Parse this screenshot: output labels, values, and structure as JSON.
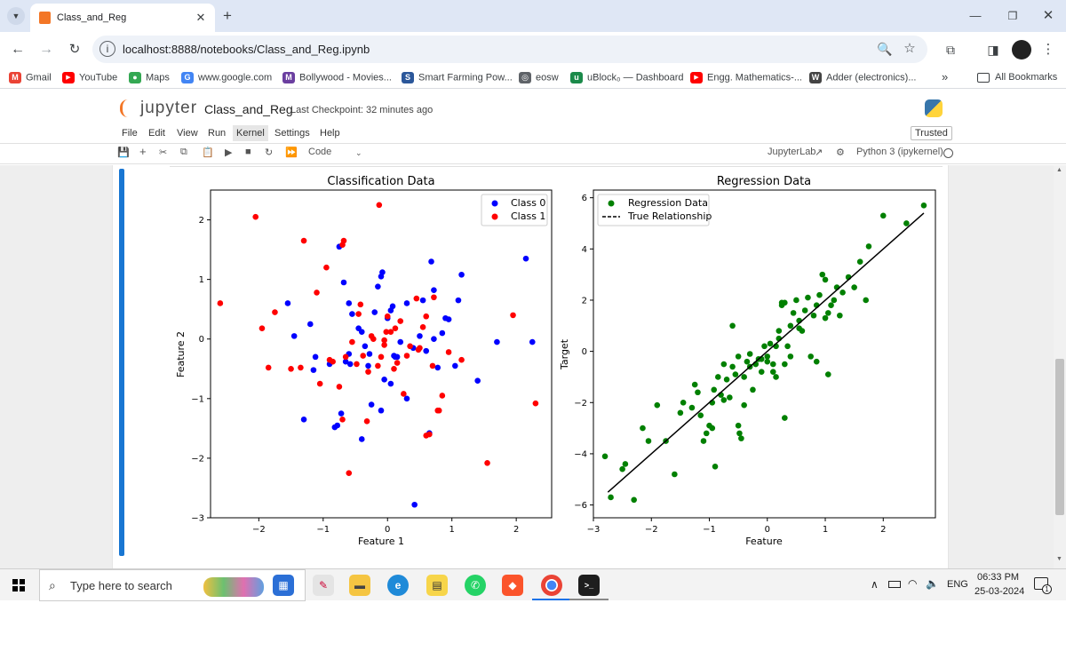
{
  "browser": {
    "tab_title": "Class_and_Reg",
    "url": "localhost:8888/notebooks/Class_and_Reg.ipynb",
    "bookmarks": [
      {
        "label": "Gmail",
        "icon": "gmail-icon",
        "color": "#ea4335",
        "glyph": "M"
      },
      {
        "label": "YouTube",
        "icon": "youtube-icon",
        "color": "#ff0000",
        "glyph": "▶"
      },
      {
        "label": "Maps",
        "icon": "maps-icon",
        "color": "#34a853",
        "glyph": "●"
      },
      {
        "label": "www.google.com",
        "icon": "google-icon",
        "color": "#4285f4",
        "glyph": "G"
      },
      {
        "label": "Bollywood - Movies...",
        "icon": "bollywood-icon",
        "color": "#6b3fa0",
        "glyph": "M"
      },
      {
        "label": "Smart Farming Pow...",
        "icon": "smart-farming-icon",
        "color": "#2b579a",
        "glyph": "S"
      },
      {
        "label": "eosw",
        "icon": "globe-icon",
        "color": "#5f6368",
        "glyph": "◎"
      },
      {
        "label": "uBlock₀ — Dashboard",
        "icon": "ublock-icon",
        "color": "#1b8a4a",
        "glyph": "u"
      },
      {
        "label": "Engg. Mathematics-...",
        "icon": "youtube-icon",
        "color": "#ff0000",
        "glyph": "▶"
      },
      {
        "label": "Adder (electronics)...",
        "icon": "wikipedia-icon",
        "color": "#444444",
        "glyph": "W"
      }
    ],
    "more_bookmarks": "»",
    "all_bookmarks": "All Bookmarks"
  },
  "jupyter": {
    "logo_text": "jupyter",
    "notebook_name": "Class_and_Reg",
    "checkpoint": "Last Checkpoint: 32 minutes ago",
    "trusted": "Trusted",
    "menu": [
      "File",
      "Edit",
      "View",
      "Run",
      "Kernel",
      "Settings",
      "Help"
    ],
    "cell_type": "Code",
    "jupyterlab_link": "JupyterLab",
    "kernel_name": "Python 3 (ipykernel)"
  },
  "taskbar": {
    "search_placeholder": "Type here to search",
    "language": "ENG",
    "time": "06:33 PM",
    "date": "25-03-2024",
    "notification_count": "1"
  },
  "chart_data": [
    {
      "type": "scatter",
      "title": "Classification Data",
      "xlabel": "Feature 1",
      "ylabel": "Feature 2",
      "xlim": [
        -2.75,
        2.55
      ],
      "ylim": [
        -3.0,
        2.5
      ],
      "xticks": [
        -2,
        -1,
        0,
        1,
        2
      ],
      "yticks": [
        -3,
        -2,
        -1,
        0,
        1,
        2
      ],
      "legend_position": "upper-right",
      "series": [
        {
          "name": "Class 0",
          "color": "#0000ff",
          "points": [
            [
              -1.3,
              -1.35
            ],
            [
              -1.15,
              -0.52
            ],
            [
              -1.12,
              -0.3
            ],
            [
              -0.9,
              -0.42
            ],
            [
              -0.65,
              -0.38
            ],
            [
              -0.6,
              -0.25
            ],
            [
              -0.55,
              0.42
            ],
            [
              -0.45,
              0.18
            ],
            [
              -0.4,
              0.12
            ],
            [
              -0.35,
              -0.12
            ],
            [
              -0.3,
              -0.45
            ],
            [
              -0.25,
              -1.1
            ],
            [
              -0.2,
              0.45
            ],
            [
              -0.15,
              0.88
            ],
            [
              -0.1,
              1.05
            ],
            [
              -0.08,
              1.12
            ],
            [
              0.0,
              0.35
            ],
            [
              0.05,
              0.48
            ],
            [
              0.08,
              0.55
            ],
            [
              0.12,
              -0.3
            ],
            [
              0.15,
              -0.3
            ],
            [
              0.2,
              -0.05
            ],
            [
              0.3,
              -1.0
            ],
            [
              0.4,
              -0.15
            ],
            [
              0.5,
              0.05
            ],
            [
              0.55,
              0.65
            ],
            [
              0.6,
              -0.2
            ],
            [
              0.65,
              -1.58
            ],
            [
              0.68,
              1.3
            ],
            [
              0.72,
              0.0
            ],
            [
              0.78,
              -0.48
            ],
            [
              0.85,
              0.1
            ],
            [
              0.9,
              0.35
            ],
            [
              0.95,
              0.33
            ],
            [
              1.05,
              -0.45
            ],
            [
              1.1,
              0.65
            ],
            [
              1.15,
              1.08
            ],
            [
              1.4,
              -0.7
            ],
            [
              1.7,
              -0.05
            ],
            [
              2.15,
              1.35
            ],
            [
              2.25,
              -0.05
            ],
            [
              -0.72,
              -1.25
            ],
            [
              -0.78,
              -1.45
            ],
            [
              -0.82,
              -1.48
            ],
            [
              -0.75,
              1.55
            ],
            [
              -0.68,
              0.95
            ],
            [
              -0.6,
              0.6
            ],
            [
              -1.2,
              0.25
            ],
            [
              -1.55,
              0.6
            ],
            [
              -1.45,
              0.05
            ],
            [
              -0.58,
              -0.42
            ],
            [
              -0.4,
              -1.68
            ],
            [
              -0.05,
              -0.68
            ],
            [
              0.05,
              -0.75
            ],
            [
              -0.1,
              -1.2
            ],
            [
              0.42,
              -2.78
            ],
            [
              0.72,
              0.82
            ],
            [
              0.3,
              0.6
            ],
            [
              0.1,
              -0.28
            ],
            [
              -0.28,
              -0.25
            ]
          ]
        },
        {
          "name": "Class 1",
          "color": "#ff0000",
          "points": [
            [
              -2.6,
              0.6
            ],
            [
              -2.05,
              2.05
            ],
            [
              -1.95,
              0.18
            ],
            [
              -1.85,
              -0.48
            ],
            [
              -1.75,
              0.45
            ],
            [
              -1.5,
              -0.5
            ],
            [
              -1.35,
              -0.48
            ],
            [
              -1.3,
              1.65
            ],
            [
              -1.1,
              0.78
            ],
            [
              -1.05,
              -0.75
            ],
            [
              -0.95,
              1.2
            ],
            [
              -0.85,
              -0.38
            ],
            [
              -0.75,
              -0.8
            ],
            [
              -0.7,
              1.58
            ],
            [
              -0.68,
              1.65
            ],
            [
              -0.65,
              -0.3
            ],
            [
              -0.6,
              -2.25
            ],
            [
              -0.55,
              -0.05
            ],
            [
              -0.48,
              -0.42
            ],
            [
              -0.42,
              0.58
            ],
            [
              -0.38,
              -0.28
            ],
            [
              -0.3,
              -0.55
            ],
            [
              -0.25,
              0.05
            ],
            [
              -0.15,
              -0.45
            ],
            [
              -0.1,
              -0.3
            ],
            [
              -0.05,
              -0.1
            ],
            [
              0.0,
              0.38
            ],
            [
              0.05,
              0.12
            ],
            [
              0.12,
              0.18
            ],
            [
              0.15,
              -0.4
            ],
            [
              0.25,
              -0.92
            ],
            [
              0.35,
              -0.12
            ],
            [
              0.45,
              0.68
            ],
            [
              0.5,
              -0.15
            ],
            [
              0.6,
              0.38
            ],
            [
              0.65,
              -1.6
            ],
            [
              0.7,
              -0.45
            ],
            [
              0.72,
              0.7
            ],
            [
              0.8,
              -1.2
            ],
            [
              0.85,
              -0.95
            ],
            [
              1.55,
              -2.08
            ],
            [
              1.95,
              0.4
            ],
            [
              2.3,
              -1.08
            ],
            [
              -0.13,
              2.25
            ],
            [
              0.3,
              -0.28
            ],
            [
              -0.32,
              -1.38
            ],
            [
              0.6,
              -1.62
            ],
            [
              0.78,
              -1.2
            ],
            [
              -0.02,
              0.12
            ],
            [
              -0.9,
              -0.35
            ],
            [
              0.2,
              0.3
            ],
            [
              -0.45,
              0.42
            ],
            [
              -0.22,
              0.0
            ],
            [
              0.48,
              -0.18
            ],
            [
              0.95,
              -0.22
            ],
            [
              -0.7,
              -1.35
            ],
            [
              0.1,
              -0.5
            ],
            [
              -0.05,
              -0.02
            ],
            [
              0.55,
              0.2
            ],
            [
              1.15,
              -0.35
            ]
          ]
        }
      ]
    },
    {
      "type": "scatter",
      "title": "Regression Data",
      "xlabel": "Feature",
      "ylabel": "Target",
      "xlim": [
        -3.0,
        2.9
      ],
      "ylim": [
        -6.5,
        6.3
      ],
      "xticks": [
        -3,
        -2,
        -1,
        0,
        1,
        2
      ],
      "yticks": [
        -6,
        -4,
        -2,
        0,
        2,
        4,
        6
      ],
      "legend_position": "upper-left",
      "series": [
        {
          "name": "Regression Data",
          "color": "#008000",
          "points": [
            [
              -2.7,
              -5.7
            ],
            [
              -2.8,
              -4.1
            ],
            [
              -2.5,
              -4.6
            ],
            [
              -2.45,
              -4.4
            ],
            [
              -2.3,
              -5.8
            ],
            [
              -2.15,
              -3.0
            ],
            [
              -2.05,
              -3.5
            ],
            [
              -1.9,
              -2.1
            ],
            [
              -1.75,
              -3.5
            ],
            [
              -1.6,
              -4.8
            ],
            [
              -1.5,
              -2.4
            ],
            [
              -1.45,
              -2.0
            ],
            [
              -1.3,
              -2.2
            ],
            [
              -1.25,
              -1.3
            ],
            [
              -1.1,
              -3.5
            ],
            [
              -1.05,
              -3.2
            ],
            [
              -1.0,
              -2.9
            ],
            [
              -0.95,
              -2.0
            ],
            [
              -0.92,
              -1.5
            ],
            [
              -0.9,
              -4.5
            ],
            [
              -0.85,
              -1.0
            ],
            [
              -0.8,
              -1.7
            ],
            [
              -0.75,
              -0.5
            ],
            [
              -0.7,
              -1.1
            ],
            [
              -0.65,
              -1.8
            ],
            [
              -0.6,
              -0.6
            ],
            [
              -0.55,
              -0.9
            ],
            [
              -0.5,
              -2.9
            ],
            [
              -0.48,
              -3.2
            ],
            [
              -0.45,
              -3.4
            ],
            [
              -0.4,
              -1.0
            ],
            [
              -0.35,
              -0.4
            ],
            [
              -0.3,
              -0.1
            ],
            [
              -0.25,
              -1.5
            ],
            [
              -0.2,
              -0.5
            ],
            [
              -0.15,
              -0.3
            ],
            [
              -0.1,
              -0.8
            ],
            [
              -0.05,
              0.2
            ],
            [
              0.0,
              -0.2
            ],
            [
              0.05,
              0.3
            ],
            [
              0.1,
              -0.5
            ],
            [
              0.15,
              -1.0
            ],
            [
              0.2,
              0.5
            ],
            [
              0.25,
              1.8
            ],
            [
              0.3,
              -0.5
            ],
            [
              0.3,
              -2.6
            ],
            [
              0.35,
              0.2
            ],
            [
              0.4,
              1.0
            ],
            [
              0.45,
              1.5
            ],
            [
              0.5,
              2.0
            ],
            [
              0.55,
              1.2
            ],
            [
              0.6,
              0.8
            ],
            [
              0.65,
              1.6
            ],
            [
              0.7,
              2.1
            ],
            [
              0.75,
              -0.2
            ],
            [
              0.8,
              1.4
            ],
            [
              0.85,
              1.8
            ],
            [
              0.9,
              2.2
            ],
            [
              0.95,
              3.0
            ],
            [
              1.0,
              2.8
            ],
            [
              1.05,
              1.5
            ],
            [
              1.1,
              1.8
            ],
            [
              1.15,
              2.0
            ],
            [
              1.2,
              2.5
            ],
            [
              1.25,
              1.4
            ],
            [
              1.3,
              2.3
            ],
            [
              1.4,
              2.9
            ],
            [
              1.5,
              2.5
            ],
            [
              1.6,
              3.5
            ],
            [
              1.7,
              2.0
            ],
            [
              1.75,
              4.1
            ],
            [
              2.0,
              5.3
            ],
            [
              2.4,
              5.0
            ],
            [
              2.7,
              5.7
            ],
            [
              -0.4,
              -2.1
            ],
            [
              -0.6,
              1.0
            ],
            [
              0.0,
              -0.4
            ],
            [
              0.15,
              0.2
            ],
            [
              0.25,
              1.9
            ],
            [
              0.3,
              1.9
            ],
            [
              0.55,
              0.9
            ],
            [
              0.85,
              -0.4
            ],
            [
              1.0,
              1.3
            ],
            [
              1.05,
              -0.9
            ],
            [
              -1.2,
              -1.6
            ],
            [
              -1.15,
              -2.5
            ],
            [
              -0.95,
              -3.0
            ],
            [
              -0.75,
              -1.9
            ],
            [
              -0.5,
              -0.2
            ],
            [
              -0.3,
              -0.6
            ],
            [
              -0.1,
              -0.3
            ],
            [
              0.1,
              -0.8
            ],
            [
              0.2,
              0.8
            ],
            [
              0.4,
              -0.2
            ]
          ]
        },
        {
          "name": "True Relationship",
          "color": "#000000",
          "style": "dashed",
          "line": [
            [
              -2.75,
              -5.5
            ],
            [
              2.7,
              5.4
            ]
          ]
        }
      ]
    }
  ]
}
